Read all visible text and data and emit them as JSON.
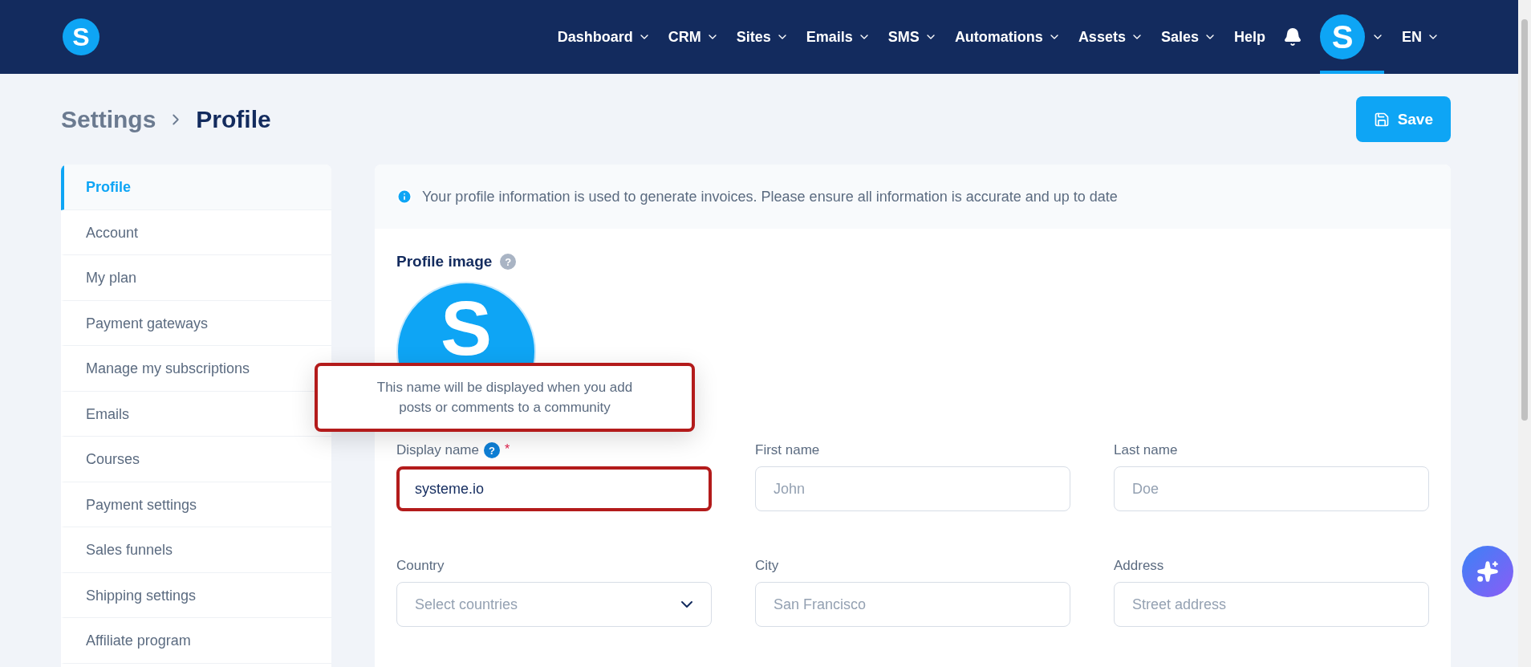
{
  "nav": {
    "logo": "S",
    "items": [
      {
        "label": "Dashboard",
        "dropdown": true
      },
      {
        "label": "CRM",
        "dropdown": true
      },
      {
        "label": "Sites",
        "dropdown": true
      },
      {
        "label": "Emails",
        "dropdown": true
      },
      {
        "label": "SMS",
        "dropdown": true
      },
      {
        "label": "Automations",
        "dropdown": true
      },
      {
        "label": "Assets",
        "dropdown": true
      },
      {
        "label": "Sales",
        "dropdown": true
      },
      {
        "label": "Help",
        "dropdown": false
      }
    ],
    "avatar": {
      "letter": "S",
      "selected": true
    },
    "language": "EN"
  },
  "breadcrumb": {
    "parent": "Settings",
    "current": "Profile"
  },
  "save_button": "Save",
  "sidebar": {
    "items": [
      {
        "label": "Profile",
        "selected": true
      },
      {
        "label": "Account",
        "selected": false
      },
      {
        "label": "My plan",
        "selected": false
      },
      {
        "label": "Payment gateways",
        "selected": false
      },
      {
        "label": "Manage my subscriptions",
        "selected": false
      },
      {
        "label": "Emails",
        "selected": false
      },
      {
        "label": "Courses",
        "selected": false
      },
      {
        "label": "Payment settings",
        "selected": false
      },
      {
        "label": "Sales funnels",
        "selected": false
      },
      {
        "label": "Shipping settings",
        "selected": false
      },
      {
        "label": "Affiliate program",
        "selected": false
      }
    ]
  },
  "info_banner": "Your profile information is used to generate invoices. Please ensure all information is accurate and up to date",
  "profile_image": {
    "label": "Profile image",
    "help": "?",
    "letter": "S"
  },
  "tooltip": {
    "text": "This name will be displayed when you add posts or comments to a community",
    "highlighted": true
  },
  "fields": [
    {
      "kind": "text",
      "label": "Display name",
      "help": "?",
      "required_mark": "*",
      "value": "systeme.io",
      "highlighted": true
    },
    {
      "kind": "text",
      "label": "First name",
      "placeholder": "John",
      "highlighted": false
    },
    {
      "kind": "text",
      "label": "Last name",
      "placeholder": "Doe",
      "highlighted": false
    },
    {
      "kind": "select",
      "label": "Country",
      "placeholder": "Select countries",
      "highlighted": false
    },
    {
      "kind": "text",
      "label": "City",
      "placeholder": "San Francisco",
      "highlighted": false
    },
    {
      "kind": "text",
      "label": "Address",
      "placeholder": "Street address",
      "highlighted": false
    }
  ]
}
